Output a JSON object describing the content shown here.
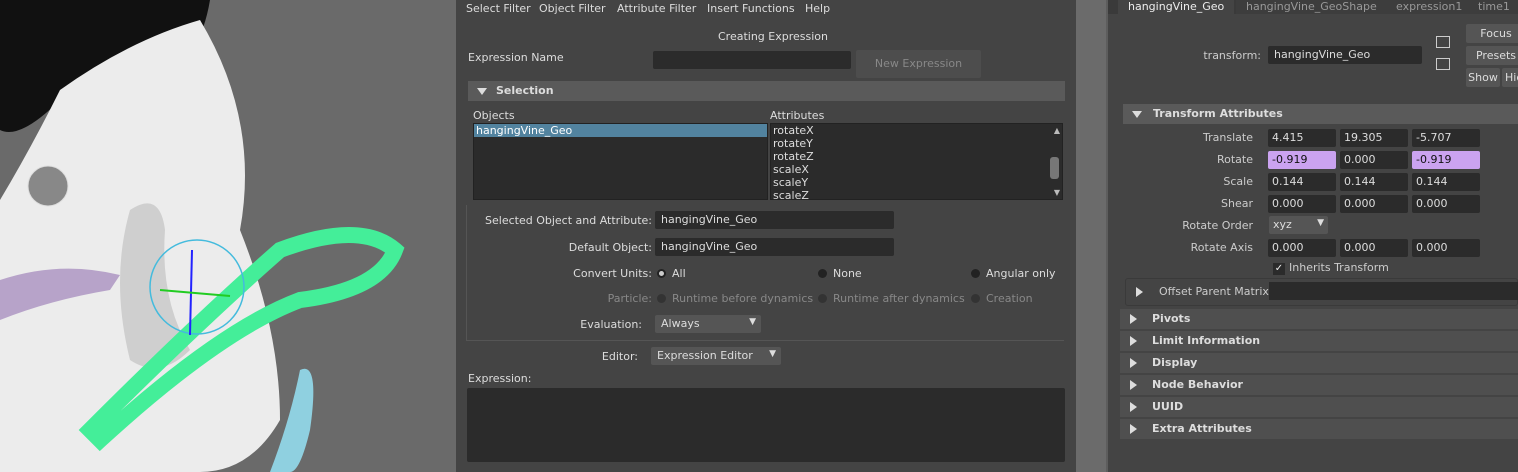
{
  "menu": [
    "Select Filter",
    "Object Filter",
    "Attribute Filter",
    "Insert Functions",
    "Help"
  ],
  "dialog": {
    "title": "Creating Expression",
    "expression_name_label": "Expression Name",
    "expression_name_value": "",
    "new_expression_button": "New Expression",
    "selection_header": "Selection",
    "objects_label": "Objects",
    "objects": [
      "hangingVine_Geo"
    ],
    "attributes_label": "Attributes",
    "attributes": [
      "rotateX",
      "rotateY",
      "rotateZ",
      "scaleX",
      "scaleY",
      "scaleZ"
    ],
    "selected_obj_attr_label": "Selected Object and Attribute:",
    "selected_obj_attr_value": "hangingVine_Geo",
    "default_object_label": "Default Object:",
    "default_object_value": "hangingVine_Geo",
    "convert_units_label": "Convert Units:",
    "convert_units_options": [
      "All",
      "None",
      "Angular only"
    ],
    "convert_units_selected": "All",
    "particle_label": "Particle:",
    "particle_options": [
      "Runtime before dynamics",
      "Runtime after dynamics",
      "Creation"
    ],
    "evaluation_label": "Evaluation:",
    "evaluation_value": "Always",
    "editor_label": "Editor:",
    "editor_value": "Expression Editor",
    "expression_label": "Expression:",
    "expression_text": ""
  },
  "attr_editor": {
    "tabs": [
      "hangingVine_Geo",
      "hangingVine_GeoShape",
      "expression1",
      "time1"
    ],
    "transform_label": "transform:",
    "transform_value": "hangingVine_Geo",
    "focus_button": "Focus",
    "presets_button": "Presets",
    "show_button": "Show",
    "hide_button": "Hide",
    "transform_attributes_header": "Transform Attributes",
    "rows": [
      {
        "label": "Translate",
        "values": [
          "4.415",
          "19.305",
          "-5.707"
        ]
      },
      {
        "label": "Rotate",
        "values": [
          "-0.919",
          "0.000",
          "-0.919"
        ]
      },
      {
        "label": "Scale",
        "values": [
          "0.144",
          "0.144",
          "0.144"
        ]
      },
      {
        "label": "Shear",
        "values": [
          "0.000",
          "0.000",
          "0.000"
        ]
      }
    ],
    "rotate_order_label": "Rotate Order",
    "rotate_order_value": "xyz",
    "rotate_axis_label": "Rotate Axis",
    "rotate_axis_values": [
      "0.000",
      "0.000",
      "0.000"
    ],
    "inherits_transform_label": "Inherits Transform",
    "inherits_transform_checked": true,
    "offset_parent_matrix_label": "Offset Parent Matrix",
    "sections": [
      "Pivots",
      "Limit Information",
      "Display",
      "Node Behavior",
      "UUID",
      "Extra Attributes"
    ],
    "keyed_color": "#cba3f0"
  }
}
